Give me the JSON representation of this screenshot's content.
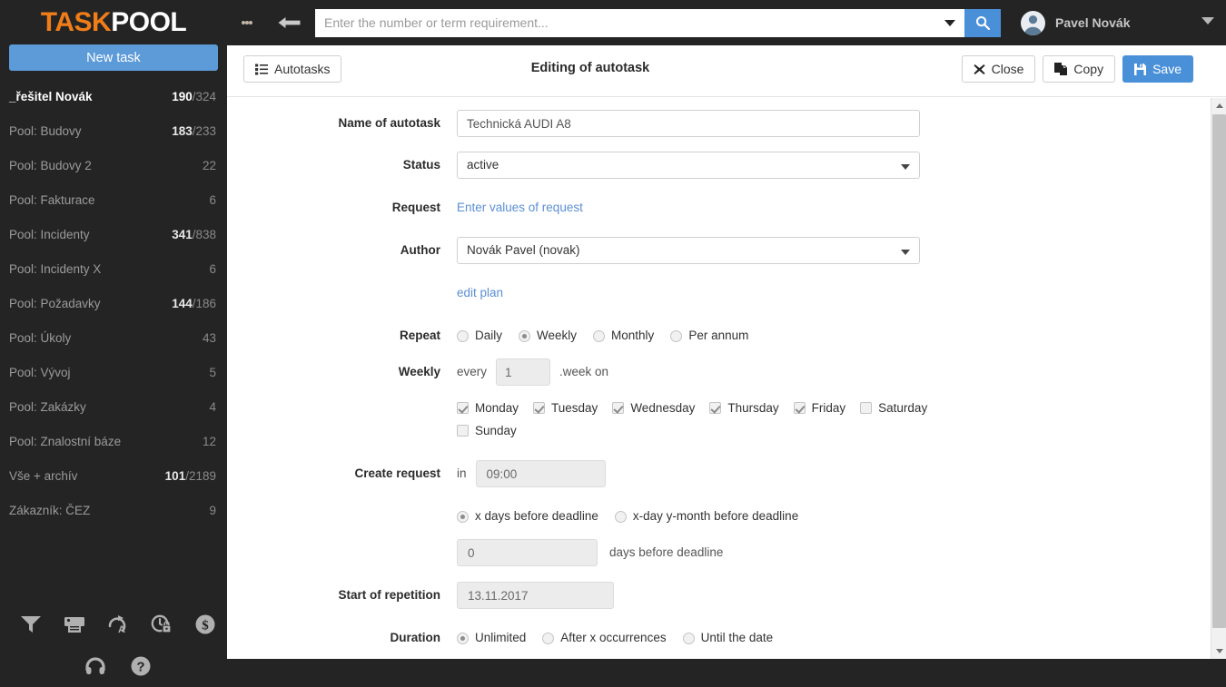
{
  "brand": {
    "part1": "TASK",
    "part2": "POOL",
    "accent": "#f07d18"
  },
  "sidebar": {
    "new_task_label": "New task",
    "items": [
      {
        "label": "_řešitel Novák",
        "count_bold": "190",
        "count_rest": "/324",
        "active": true
      },
      {
        "label": "Pool: Budovy",
        "count_bold": "183",
        "count_rest": "/233",
        "active": false
      },
      {
        "label": "Pool: Budovy 2",
        "count_bold": "",
        "count_rest": "22",
        "active": false
      },
      {
        "label": "Pool: Fakturace",
        "count_bold": "",
        "count_rest": "6",
        "active": false
      },
      {
        "label": "Pool: Incidenty",
        "count_bold": "341",
        "count_rest": "/838",
        "active": false
      },
      {
        "label": "Pool: Incidenty X",
        "count_bold": "",
        "count_rest": "6",
        "active": false
      },
      {
        "label": "Pool: Požadavky",
        "count_bold": "144",
        "count_rest": "/186",
        "active": false
      },
      {
        "label": "Pool: Úkoly",
        "count_bold": "",
        "count_rest": "43",
        "active": false
      },
      {
        "label": "Pool: Vývoj",
        "count_bold": "",
        "count_rest": "5",
        "active": false
      },
      {
        "label": "Pool: Zakázky",
        "count_bold": "",
        "count_rest": "4",
        "active": false
      },
      {
        "label": "Pool: Znalostní báze",
        "count_bold": "",
        "count_rest": "12",
        "active": false
      },
      {
        "label": "Vše + archív",
        "count_bold": "101",
        "count_rest": "/2189",
        "active": false
      },
      {
        "label": "Zákazník: ČEZ",
        "count_bold": "",
        "count_rest": "9",
        "active": false
      }
    ],
    "bottom_icons_row1": [
      "filter-icon",
      "print-icon",
      "autotask-icon",
      "time-lock-icon",
      "dollar-icon"
    ],
    "bottom_icons_row2": [
      "headset-icon",
      "help-icon"
    ]
  },
  "topbar": {
    "menu_icon": "vertical-dots-icon",
    "back_icon": "arrow-left-icon",
    "search_placeholder": "Enter the number or term requirement...",
    "search_value": "",
    "search_icon": "magnifier-icon",
    "dropdown_icon": "chevron-down-icon",
    "user_name": "Pavel Novák",
    "avatar_icon": "user-avatar-icon",
    "user_caret_icon": "chevron-down-icon",
    "accent": "#4a90d9"
  },
  "toolbar": {
    "autotasks_label": "Autotasks",
    "autotasks_icon": "list-icon",
    "title": "Editing of autotask",
    "close_label": "Close",
    "close_icon": "x-icon",
    "copy_label": "Copy",
    "copy_icon": "copy-icon",
    "save_label": "Save",
    "save_icon": "floppy-disk-icon"
  },
  "form": {
    "name_label": "Name of autotask",
    "name_value": "Technická AUDI A8",
    "status_label": "Status",
    "status_value": "active",
    "request_label": "Request",
    "request_link": "Enter values of request",
    "author_label": "Author",
    "author_value": "Novák Pavel (novak)",
    "edit_plan_link": "edit plan",
    "repeat_label": "Repeat",
    "repeat_options": [
      {
        "label": "Daily",
        "selected": false
      },
      {
        "label": "Weekly",
        "selected": true
      },
      {
        "label": "Monthly",
        "selected": false
      },
      {
        "label": "Per annum",
        "selected": false
      }
    ],
    "weekly_label": "Weekly",
    "weekly_every": "every",
    "weekly_count": "1",
    "weekly_suffix": ".week on",
    "days": [
      {
        "label": "Monday",
        "checked": true
      },
      {
        "label": "Tuesday",
        "checked": true
      },
      {
        "label": "Wednesday",
        "checked": true
      },
      {
        "label": "Thursday",
        "checked": true
      },
      {
        "label": "Friday",
        "checked": true
      },
      {
        "label": "Saturday",
        "checked": false
      },
      {
        "label": "Sunday",
        "checked": false
      }
    ],
    "create_request_label": "Create request",
    "create_request_in": "in",
    "create_request_time": "09:00",
    "deadline_options": [
      {
        "label": "x days before deadline",
        "selected": true
      },
      {
        "label": "x-day y-month before deadline",
        "selected": false
      }
    ],
    "days_before_value": "0",
    "days_before_suffix": "days before deadline",
    "start_repetition_label": "Start of repetition",
    "start_repetition_value": "13.11.2017",
    "duration_label": "Duration",
    "duration_options": [
      {
        "label": "Unlimited",
        "selected": true
      },
      {
        "label": "After x occurrences",
        "selected": false
      },
      {
        "label": "Until the date",
        "selected": false
      }
    ]
  },
  "scrollbar": {
    "up_icon": "triangle-up-icon",
    "down_icon": "triangle-down-icon"
  }
}
